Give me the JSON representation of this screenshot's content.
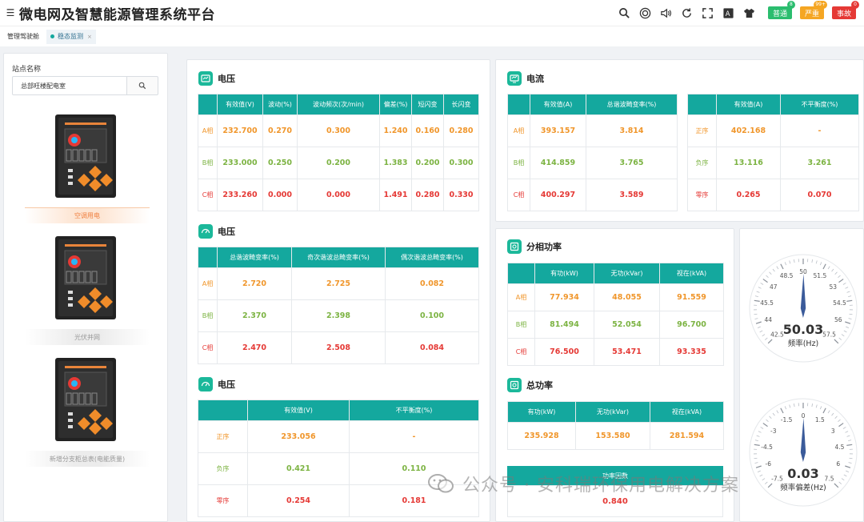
{
  "app": {
    "title": "微电网及智慧能源管理系统平台"
  },
  "header": {
    "icons": [
      "search-icon",
      "target-icon",
      "volume-icon",
      "refresh-icon",
      "fullscreen-icon",
      "font-size-icon",
      "theme-shirt-icon"
    ],
    "alarms": [
      {
        "label": "普通",
        "count": "8",
        "color": "#2bbd6e"
      },
      {
        "label": "严重",
        "count": "99+",
        "color": "#f5a623"
      },
      {
        "label": "事故",
        "count": "0",
        "color": "#e53935"
      }
    ]
  },
  "tabs": [
    {
      "label": "管理驾驶舱",
      "active": false
    },
    {
      "label": "稳态监测",
      "active": true
    }
  ],
  "sidebar": {
    "label": "站点名称",
    "search_value": "总部旺楼配电室",
    "devices": [
      {
        "name": "空调用电",
        "active": true
      },
      {
        "name": "光伏并网",
        "active": false
      },
      {
        "name": "新增分支柜总表(电能质量)",
        "active": false
      }
    ]
  },
  "voltage1": {
    "title": "电压",
    "headers": [
      "",
      "有效值(V)",
      "波动(%)",
      "波动频次(次/min)",
      "偏差(%)",
      "短闪变",
      "长闪变"
    ],
    "rows": [
      {
        "phase": "A相",
        "values": [
          "232.700",
          "0.270",
          "0.300",
          "1.240",
          "0.160",
          "0.280"
        ]
      },
      {
        "phase": "B相",
        "values": [
          "233.000",
          "0.250",
          "0.200",
          "1.383",
          "0.200",
          "0.300"
        ]
      },
      {
        "phase": "C相",
        "values": [
          "233.260",
          "0.000",
          "0.000",
          "1.491",
          "0.280",
          "0.330"
        ]
      }
    ]
  },
  "voltage2": {
    "title": "电压",
    "headers": [
      "",
      "总谐波畸变率(%)",
      "奇次谐波总畸变率(%)",
      "偶次谐波总畸变率(%)"
    ],
    "rows": [
      {
        "phase": "A相",
        "values": [
          "2.720",
          "2.725",
          "0.082"
        ]
      },
      {
        "phase": "B相",
        "values": [
          "2.370",
          "2.398",
          "0.100"
        ]
      },
      {
        "phase": "C相",
        "values": [
          "2.470",
          "2.508",
          "0.084"
        ]
      }
    ]
  },
  "voltage3": {
    "title": "电压",
    "headers": [
      "",
      "有效值(V)",
      "不平衡度(%)"
    ],
    "rows": [
      {
        "phase": "正序",
        "values": [
          "233.056",
          "-"
        ]
      },
      {
        "phase": "负序",
        "values": [
          "0.421",
          "0.110"
        ]
      },
      {
        "phase": "零序",
        "values": [
          "0.254",
          "0.181"
        ]
      }
    ]
  },
  "current": {
    "title": "电流",
    "headers": [
      "",
      "有效值(A)",
      "总谐波畸变率(%)"
    ],
    "rows": [
      {
        "phase": "A相",
        "values": [
          "393.157",
          "3.814"
        ]
      },
      {
        "phase": "B相",
        "values": [
          "414.859",
          "3.765"
        ]
      },
      {
        "phase": "C相",
        "values": [
          "400.297",
          "3.589"
        ]
      }
    ]
  },
  "current_seq": {
    "headers": [
      "",
      "有效值(A)",
      "不平衡度(%)"
    ],
    "rows": [
      {
        "phase": "正序",
        "values": [
          "402.168",
          "-"
        ]
      },
      {
        "phase": "负序",
        "values": [
          "13.116",
          "3.261"
        ]
      },
      {
        "phase": "零序",
        "values": [
          "0.265",
          "0.070"
        ]
      }
    ]
  },
  "phase_power": {
    "title": "分相功率",
    "headers": [
      "",
      "有功(kW)",
      "无功(kVar)",
      "视在(kVA)"
    ],
    "rows": [
      {
        "phase": "A相",
        "values": [
          "77.934",
          "48.055",
          "91.559"
        ]
      },
      {
        "phase": "B相",
        "values": [
          "81.494",
          "52.054",
          "96.700"
        ]
      },
      {
        "phase": "C相",
        "values": [
          "76.500",
          "53.471",
          "93.335"
        ]
      }
    ]
  },
  "total_power": {
    "title": "总功率",
    "headers": [
      "有功(kW)",
      "无功(kVar)",
      "视在(kVA)"
    ],
    "values": [
      "235.928",
      "153.580",
      "281.594"
    ],
    "pf_label": "功率因数",
    "pf_value": "0.840"
  },
  "gauge_freq": {
    "value": 50.03,
    "value_text": "50.03",
    "label": "频率(Hz)",
    "min": 42.5,
    "max": 57.5,
    "ticks": [
      "42.5",
      "44",
      "45.5",
      "47",
      "48.5",
      "50",
      "51.5",
      "53",
      "54.5",
      "56",
      "57.5"
    ]
  },
  "gauge_dev": {
    "value": 0.03,
    "value_text": "0.03",
    "label": "频率偏差(Hz)",
    "min": -7.5,
    "max": 7.5,
    "ticks": [
      "-7.5",
      "-6",
      "-4.5",
      "-3",
      "-1.5",
      "0",
      "1.5",
      "3",
      "4.5",
      "6",
      "7.5"
    ]
  },
  "watermark": {
    "text": "公众号 · 安科瑞环保用电解决方案"
  },
  "colors": {
    "teal": "#14a89e",
    "orange": "#f0962b",
    "green": "#7cb342",
    "red": "#e53935"
  }
}
